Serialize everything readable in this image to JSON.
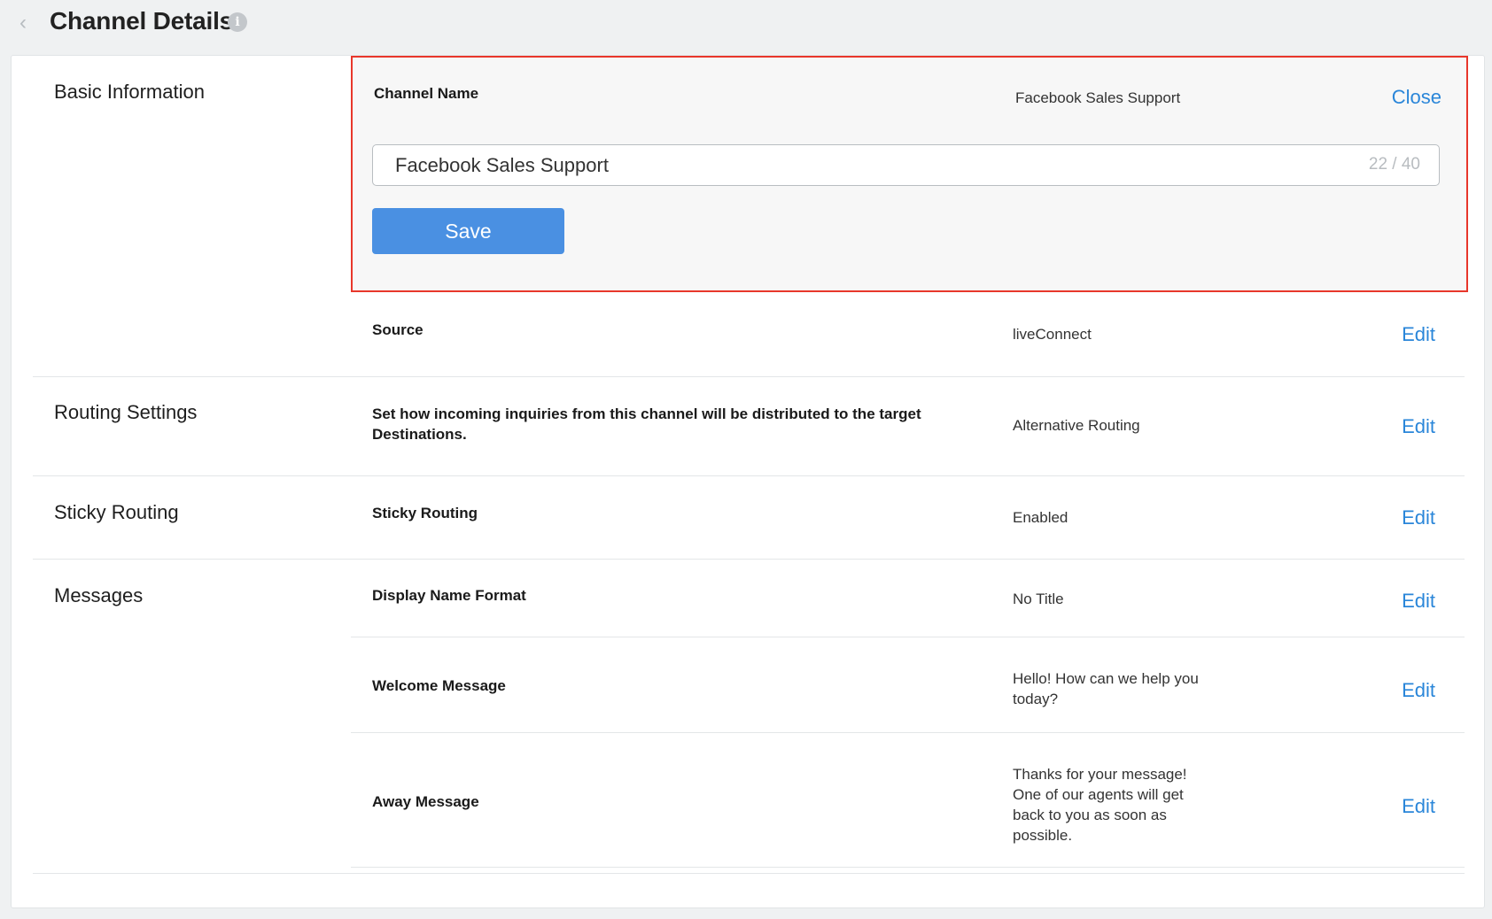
{
  "header": {
    "title": "Channel Details",
    "back_icon": "chevron-left-icon",
    "info_icon": "info-icon",
    "info_glyph": "i"
  },
  "basic_information": {
    "title": "Basic Information",
    "channel_name": {
      "label": "Channel Name",
      "value": "Facebook Sales Support",
      "close_label": "Close",
      "input_value": "Facebook Sales Support",
      "char_count": "22 / 40",
      "save_label": "Save"
    },
    "source": {
      "label": "Source",
      "value": "liveConnect",
      "edit_label": "Edit"
    }
  },
  "routing_settings": {
    "title": "Routing Settings",
    "description": "Set how incoming inquiries from this channel will be distributed to the target Destinations.",
    "value": "Alternative Routing",
    "edit_label": "Edit"
  },
  "sticky_routing": {
    "title": "Sticky Routing",
    "label": "Sticky Routing",
    "value": "Enabled",
    "edit_label": "Edit"
  },
  "messages": {
    "title": "Messages",
    "display_name_format": {
      "label": "Display Name Format",
      "value": "No Title",
      "edit_label": "Edit"
    },
    "welcome_message": {
      "label": "Welcome Message",
      "value": "Hello! How can we help you today?",
      "edit_label": "Edit"
    },
    "away_message": {
      "label": "Away Message",
      "value": "Thanks for your message! One of our agents will get back to you as soon as possible.",
      "edit_label": "Edit"
    }
  },
  "colors": {
    "accent": "#2a86d9",
    "save_button": "#4a90e2",
    "highlight_border": "#e8372b"
  }
}
